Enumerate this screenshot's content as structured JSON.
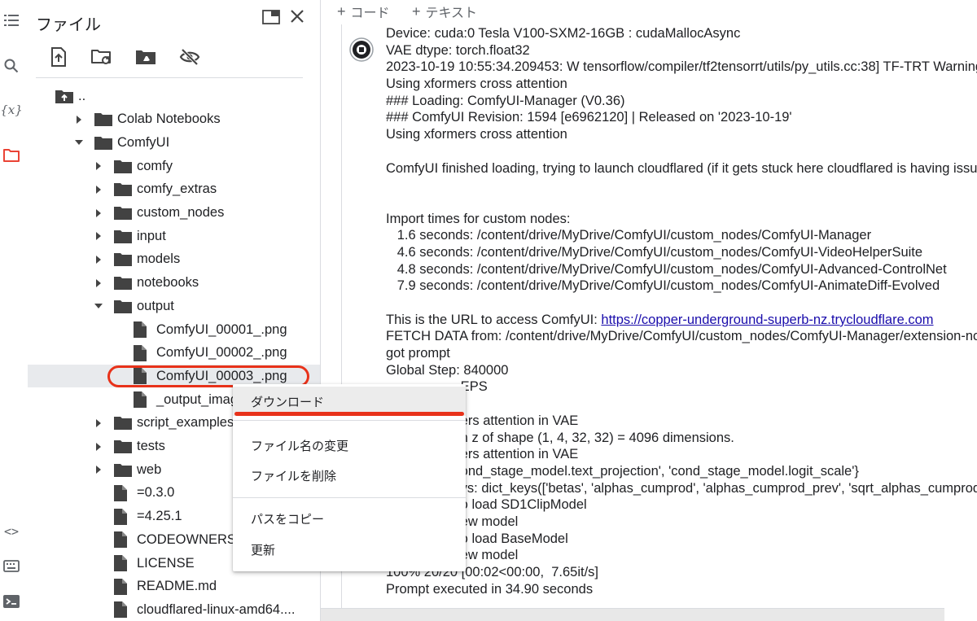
{
  "panel": {
    "title": "ファイル"
  },
  "tree": [
    {
      "label": "..",
      "kind": "up",
      "depth": 0,
      "arrow": "none"
    },
    {
      "label": "Colab Notebooks",
      "kind": "folder",
      "depth": 1,
      "arrow": "right"
    },
    {
      "label": "ComfyUI",
      "kind": "folder",
      "depth": 1,
      "arrow": "down"
    },
    {
      "label": "comfy",
      "kind": "folder",
      "depth": 2,
      "arrow": "right"
    },
    {
      "label": "comfy_extras",
      "kind": "folder",
      "depth": 2,
      "arrow": "right"
    },
    {
      "label": "custom_nodes",
      "kind": "folder",
      "depth": 2,
      "arrow": "right"
    },
    {
      "label": "input",
      "kind": "folder",
      "depth": 2,
      "arrow": "right"
    },
    {
      "label": "models",
      "kind": "folder",
      "depth": 2,
      "arrow": "right"
    },
    {
      "label": "notebooks",
      "kind": "folder",
      "depth": 2,
      "arrow": "right"
    },
    {
      "label": "output",
      "kind": "folder",
      "depth": 2,
      "arrow": "down"
    },
    {
      "label": "ComfyUI_00001_.png",
      "kind": "file",
      "depth": 3,
      "arrow": "none"
    },
    {
      "label": "ComfyUI_00002_.png",
      "kind": "file",
      "depth": 3,
      "arrow": "none"
    },
    {
      "label": "ComfyUI_00003_.png",
      "kind": "file",
      "depth": 3,
      "arrow": "none",
      "selected": true
    },
    {
      "label": "_output_imag",
      "kind": "file",
      "depth": 3,
      "arrow": "none"
    },
    {
      "label": "script_examples",
      "kind": "folder",
      "depth": 2,
      "arrow": "right"
    },
    {
      "label": "tests",
      "kind": "folder",
      "depth": 2,
      "arrow": "right"
    },
    {
      "label": "web",
      "kind": "folder",
      "depth": 2,
      "arrow": "right"
    },
    {
      "label": "=0.3.0",
      "kind": "file",
      "depth": 2,
      "arrow": "none"
    },
    {
      "label": "=4.25.1",
      "kind": "file",
      "depth": 2,
      "arrow": "none"
    },
    {
      "label": "CODEOWNERS",
      "kind": "file",
      "depth": 2,
      "arrow": "none"
    },
    {
      "label": "LICENSE",
      "kind": "file",
      "depth": 2,
      "arrow": "none"
    },
    {
      "label": "README.md",
      "kind": "file",
      "depth": 2,
      "arrow": "none"
    },
    {
      "label": "cloudflared-linux-amd64....",
      "kind": "file",
      "depth": 2,
      "arrow": "none"
    }
  ],
  "topbar": {
    "add_code": "コード",
    "add_text": "テキスト"
  },
  "output_lines": [
    "Device: cuda:0 Tesla V100-SXM2-16GB : cudaMallocAsync",
    "VAE dtype: torch.float32",
    "2023-10-19 10:55:34.209453: W tensorflow/compiler/tf2tensorrt/utils/py_utils.cc:38] TF-TRT Warning",
    "Using xformers cross attention",
    "### Loading: ComfyUI-Manager (V0.36)",
    "### ComfyUI Revision: 1594 [e6962120] | Released on '2023-10-19'",
    "Using xformers cross attention",
    "",
    "ComfyUI finished loading, trying to launch cloudflared (if it gets stuck here cloudflared is having issues)",
    "",
    "",
    "Import times for custom nodes:",
    "   1.6 seconds: /content/drive/MyDrive/ComfyUI/custom_nodes/ComfyUI-Manager",
    "   4.6 seconds: /content/drive/MyDrive/ComfyUI/custom_nodes/ComfyUI-VideoHelperSuite",
    "   4.8 seconds: /content/drive/MyDrive/ComfyUI/custom_nodes/ComfyUI-Advanced-ControlNet",
    "   7.9 seconds: /content/drive/MyDrive/ComfyUI/custom_nodes/ComfyUI-AnimateDiff-Evolved",
    "",
    "This is the URL to access ComfyUI: ",
    "FETCH DATA from: /content/drive/MyDrive/ComfyUI/custom_nodes/ComfyUI-Manager/extension-node-map.json",
    "got prompt",
    "Global Step: 840000",
    "                    EPS",
    "",
    "                    ers attention in VAE",
    "                    h z of shape (1, 4, 32, 32) = 4096 dimensions.",
    "                    ers attention in VAE",
    "                    ond_stage_model.text_projection', 'cond_stage_model.logit_scale'}",
    "                    ys: dict_keys(['betas', 'alphas_cumprod', 'alphas_cumprod_prev', 'sqrt_alphas_cumprod'])",
    "                    o load SD1ClipModel",
    "                    ew model",
    "                    o load BaseModel",
    "                    ew model",
    "100% 20/20 [00:02<00:00,  7.65it/s]",
    "Prompt executed in 34.90 seconds"
  ],
  "output_url": "https://copper-underground-superb-nz.trycloudflare.com",
  "context_menu": {
    "download": "ダウンロード",
    "rename": "ファイル名の変更",
    "delete": "ファイルを削除",
    "copy_path": "パスをコピー",
    "refresh": "更新"
  },
  "colors": {
    "accent": "#e8321a",
    "folder": "#424242",
    "link": "#1a0dab",
    "files_active": "#ea4335"
  }
}
